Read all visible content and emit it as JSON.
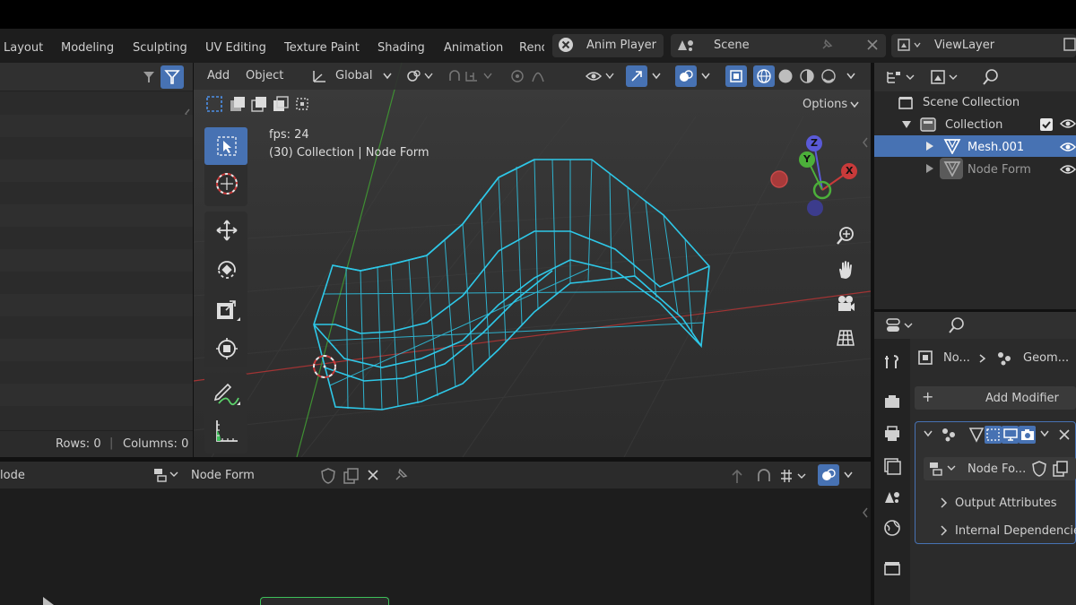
{
  "topbar": {
    "workspace_tabs": [
      "Layout",
      "Modeling",
      "Sculpting",
      "UV Editing",
      "Texture Paint",
      "Shading",
      "Animation",
      "Rend"
    ],
    "anim_player_label": "Anim Player",
    "scene_label": "Scene",
    "viewlayer_label": "ViewLayer"
  },
  "spreadsheet": {
    "rows_label": "Rows: 0",
    "columns_label": "Columns: 0"
  },
  "viewport": {
    "menu": {
      "add": "Add",
      "object": "Object"
    },
    "orientation": "Global",
    "options_label": "Options",
    "fps_text": "fps: 24",
    "context_text": "(30) Collection | Node Form",
    "gizmo": {
      "x": "X",
      "y": "Y",
      "z": "Z"
    },
    "colors": {
      "wire": "#2ec8e8",
      "x_axis": "#c83a3a",
      "y_axis": "#4caf3a",
      "z_axis": "#5a5ad8"
    }
  },
  "outliner": {
    "scene_collection": "Scene Collection",
    "collection": "Collection",
    "items": [
      {
        "label": "Mesh.001",
        "selected": true
      },
      {
        "label": "Node Form",
        "selected": false
      }
    ]
  },
  "properties": {
    "breadcrumb_obj": "No...",
    "breadcrumb_mod": "Geom...",
    "add_modifier": "Add Modifier",
    "node_group_name": "Node Fo...",
    "panels": [
      "Output Attributes",
      "Internal Dependencies"
    ]
  },
  "node_editor": {
    "editor_label": "lode",
    "node_group_name": "Node Form"
  }
}
